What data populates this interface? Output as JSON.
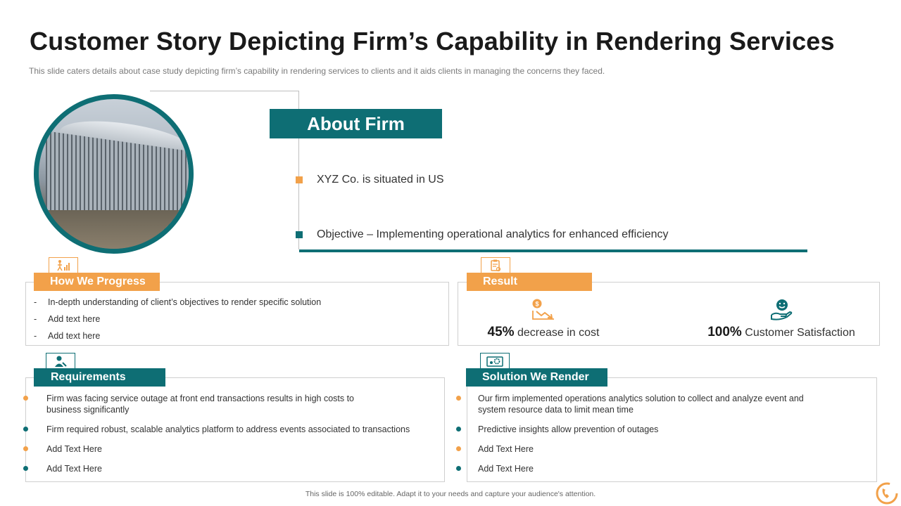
{
  "title": "Customer Story Depicting Firm’s Capability in Rendering Services",
  "subtitle": "This slide caters details about case study depicting firm’s capability in rendering services to clients and it aids clients in managing the concerns they faced.",
  "about": {
    "heading": "About Firm",
    "items": [
      "XYZ Co. is situated in US",
      "Objective – Implementing operational analytics for enhanced efficiency"
    ]
  },
  "progress": {
    "heading": "How We Progress",
    "items": [
      "In-depth understanding of client’s objectives to render specific solution",
      "Add text here",
      "Add text here"
    ]
  },
  "result": {
    "heading": "Result",
    "metric1": {
      "value": "45%",
      "label": " decrease in cost"
    },
    "metric2": {
      "value": "100%",
      "label": " Customer Satisfaction"
    }
  },
  "requirements": {
    "heading": "Requirements",
    "items": [
      "Firm was facing service outage at front end transactions results in high costs to business significantly",
      "Firm required robust, scalable analytics platform to address events associated to transactions",
      "Add Text Here",
      "Add Text Here"
    ]
  },
  "solution": {
    "heading": "Solution We Render",
    "items": [
      "Our firm implemented operations analytics solution to collect and analyze event and system resource data to limit mean time",
      "Predictive insights allow prevention of outages",
      "Add Text Here",
      "Add Text Here"
    ]
  },
  "footer": "This slide is 100% editable. Adapt it to your needs and capture your audience's attention.",
  "colors": {
    "teal": "#0e6e74",
    "orange": "#f2a14a"
  }
}
